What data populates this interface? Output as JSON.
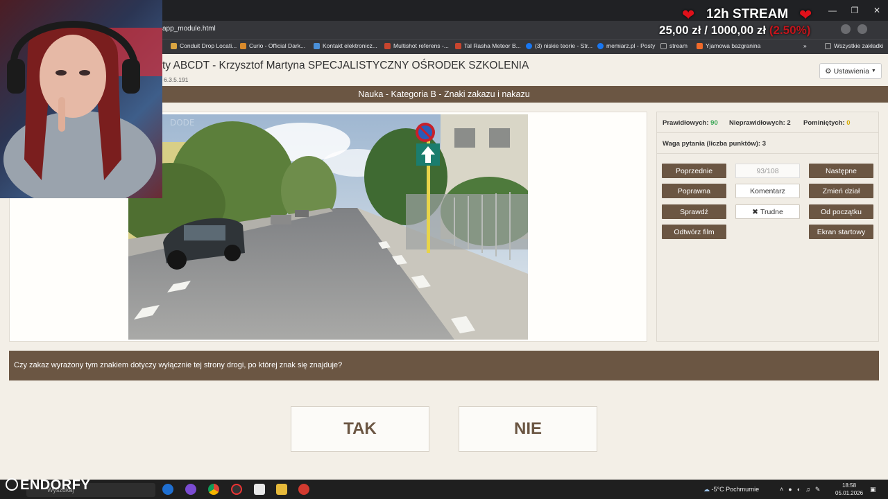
{
  "window": {
    "url": "app_module.html"
  },
  "bookmarks": [
    {
      "label": "Conduit Drop Locati...",
      "color": "#d9a441"
    },
    {
      "label": "Curio - Official Dark...",
      "color": "#d98a2b"
    },
    {
      "label": "Kontakt elektronicz...",
      "color": "#4a90d9"
    },
    {
      "label": "Multishot referens -...",
      "color": "#c8452e"
    },
    {
      "label": "Tal Rasha Meteor B...",
      "color": "#c8452e"
    },
    {
      "label": "(3) niskie teorie - Str...",
      "color": "#1877f2"
    },
    {
      "label": "memiarz.pl - Posty",
      "color": "#1877f2"
    },
    {
      "label": "stream",
      "color": "#aaaaaa"
    },
    {
      "label": "Yjamowa bazgranina",
      "color": "#f06a2a"
    },
    {
      "label": "Wszystkie zakładki",
      "color": "#aaaaaa"
    }
  ],
  "overlay": {
    "title": "12h STREAM",
    "amount": "25,00 zł",
    "separator": "/",
    "goal": "1000,00 zł",
    "percent": "(2.50%)"
  },
  "app": {
    "title": "ty ABCDT - Krzysztof Martyna SPECJALISTYCZNY OŚRODEK SZKOLENIA",
    "version": "6.3.5.191",
    "settings_label": "Ustawienia",
    "section": "Nauka - Kategoria B - Znaki zakazu i nakazu"
  },
  "stats": {
    "correct_label": "Prawidłowych:",
    "correct_value": "90",
    "wrong_label": "Nieprawidłowych:",
    "wrong_value": "2",
    "skipped_label": "Pominiętych:",
    "skipped_value": "0",
    "weight_label": "Waga pytania (liczba punktów): 3"
  },
  "buttons": {
    "prev": "Poprzednie",
    "counter": "93/108",
    "next": "Następne",
    "correct": "Poprawna",
    "comment": "Komentarz",
    "change_section": "Zmień dział",
    "check": "Sprawdź",
    "hard": "Trudne",
    "restart": "Od początku",
    "play_video": "Odtwórz film",
    "home_screen": "Ekran startowy"
  },
  "question": {
    "text": "Czy zakaz wyrażony tym znakiem dotyczy wyłącznie tej strony drogi, po której znak się znajduje?",
    "yes": "TAK",
    "no": "NIE"
  },
  "taskbar": {
    "brand": "ENDORFY",
    "search_placeholder": "Wyszukaj",
    "weather": "-5°C  Pochmurnie",
    "time": "18:58",
    "date": "05.01.2026"
  }
}
